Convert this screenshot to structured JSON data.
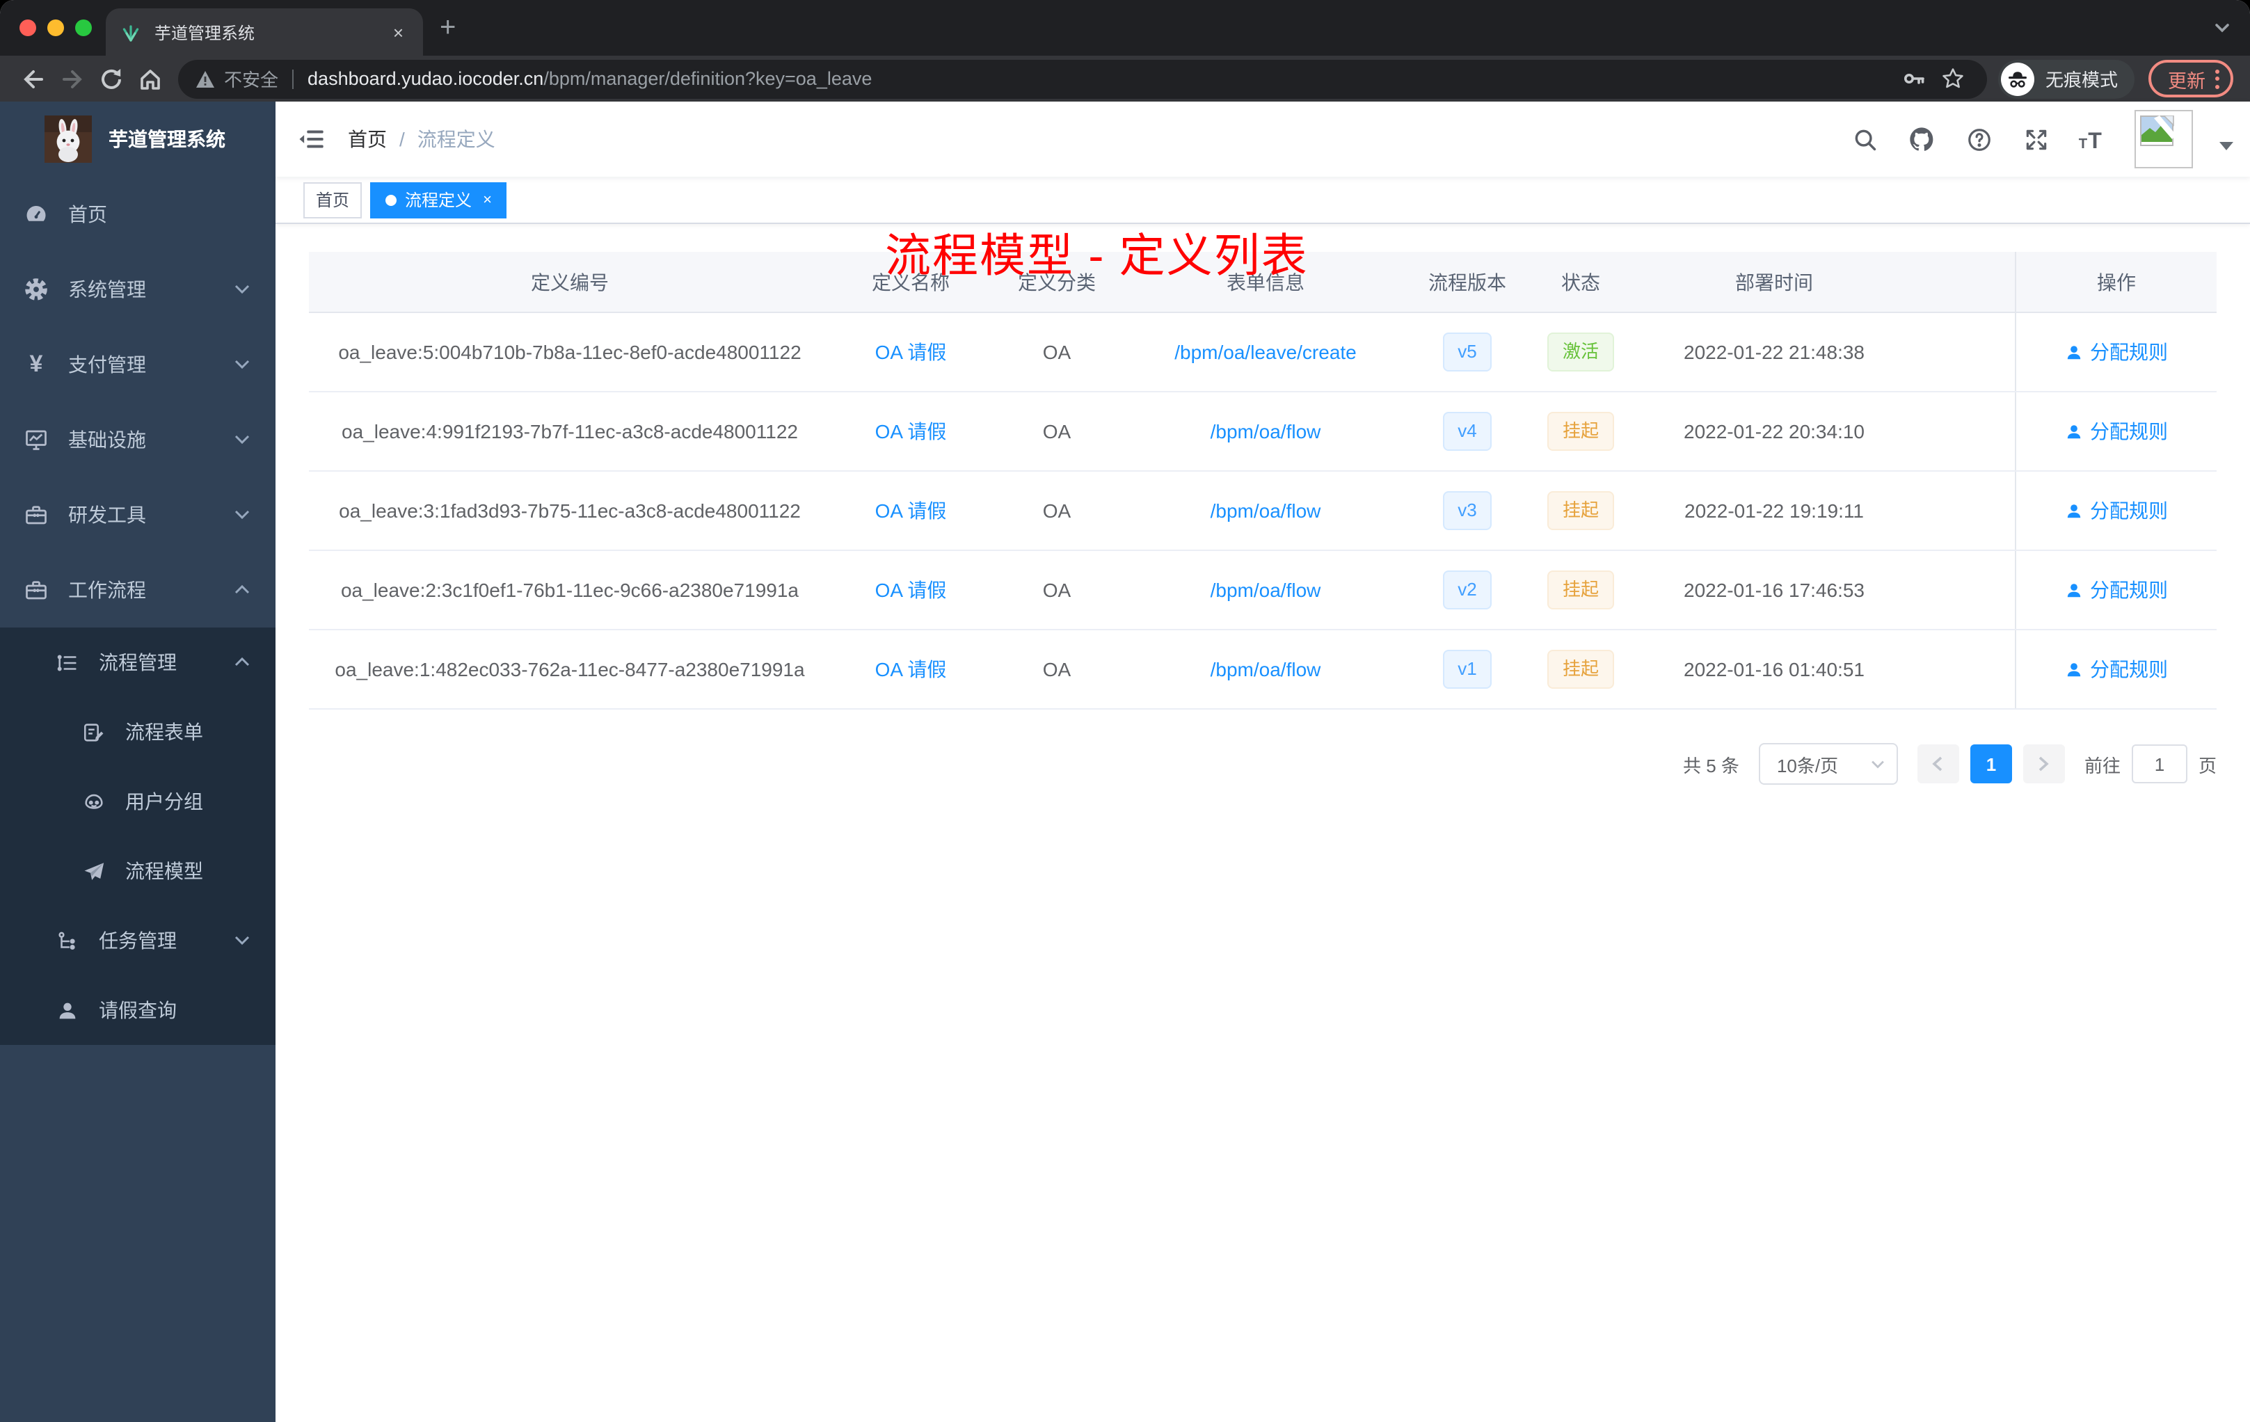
{
  "colors": {
    "accent": "#1890ff",
    "success": "#67c23a",
    "warning": "#e6a23c",
    "annotation": "#ff0000",
    "sidebar_bg": "#304156",
    "submenu_bg": "#1f2d3d"
  },
  "browser": {
    "tab_title": "芋道管理系统",
    "tab_close": "×",
    "new_tab": "+",
    "security_label": "不安全",
    "url_host": "dashboard.yudao.iocoder.cn",
    "url_path": "/bpm/manager/definition?key=oa_leave",
    "incognito_label": "无痕模式",
    "update_label": "更新"
  },
  "sidebar": {
    "logo_title": "芋道管理系统",
    "items": [
      {
        "label": "首页",
        "icon": "dashboard-icon"
      },
      {
        "label": "系统管理",
        "icon": "gear-icon"
      },
      {
        "label": "支付管理",
        "icon": "yuan-icon"
      },
      {
        "label": "基础设施",
        "icon": "monitor-icon"
      },
      {
        "label": "研发工具",
        "icon": "toolbox-icon"
      },
      {
        "label": "工作流程",
        "icon": "toolbox-icon"
      },
      {
        "label": "流程管理",
        "icon": "list-tree-icon"
      },
      {
        "label": "流程表单",
        "icon": "form-icon"
      },
      {
        "label": "用户分组",
        "icon": "user-group-icon"
      },
      {
        "label": "流程模型",
        "icon": "paper-plane-icon"
      },
      {
        "label": "任务管理",
        "icon": "flow-icon"
      },
      {
        "label": "请假查询",
        "icon": "person-icon"
      }
    ]
  },
  "navbar": {
    "breadcrumb_home": "首页",
    "breadcrumb_sep": "/",
    "breadcrumb_current": "流程定义"
  },
  "annotation": "流程模型 - 定义列表",
  "tags": {
    "home": "首页",
    "active": "流程定义",
    "close": "×"
  },
  "table": {
    "columns": [
      "定义编号",
      "定义名称",
      "定义分类",
      "表单信息",
      "流程版本",
      "状态",
      "部署时间",
      "操作"
    ],
    "rows": [
      {
        "id": "oa_leave:5:004b710b-7b8a-11ec-8ef0-acde48001122",
        "name": "OA 请假",
        "category": "OA",
        "form": "/bpm/oa/leave/create",
        "version": "v5",
        "status": "激活",
        "deployed": "2022-01-22 21:48:38",
        "action": "分配规则"
      },
      {
        "id": "oa_leave:4:991f2193-7b7f-11ec-a3c8-acde48001122",
        "name": "OA 请假",
        "category": "OA",
        "form": "/bpm/oa/flow",
        "version": "v4",
        "status": "挂起",
        "deployed": "2022-01-22 20:34:10",
        "action": "分配规则"
      },
      {
        "id": "oa_leave:3:1fad3d93-7b75-11ec-a3c8-acde48001122",
        "name": "OA 请假",
        "category": "OA",
        "form": "/bpm/oa/flow",
        "version": "v3",
        "status": "挂起",
        "deployed": "2022-01-22 19:19:11",
        "action": "分配规则"
      },
      {
        "id": "oa_leave:2:3c1f0ef1-76b1-11ec-9c66-a2380e71991a",
        "name": "OA 请假",
        "category": "OA",
        "form": "/bpm/oa/flow",
        "version": "v2",
        "status": "挂起",
        "deployed": "2022-01-16 17:46:53",
        "action": "分配规则"
      },
      {
        "id": "oa_leave:1:482ec033-762a-11ec-8477-a2380e71991a",
        "name": "OA 请假",
        "category": "OA",
        "form": "/bpm/oa/flow",
        "version": "v1",
        "status": "挂起",
        "deployed": "2022-01-16 01:40:51",
        "action": "分配规则"
      }
    ]
  },
  "pagination": {
    "total": "共 5 条",
    "page_size": "10条/页",
    "page": "1",
    "goto": "前往",
    "page_unit": "页"
  }
}
